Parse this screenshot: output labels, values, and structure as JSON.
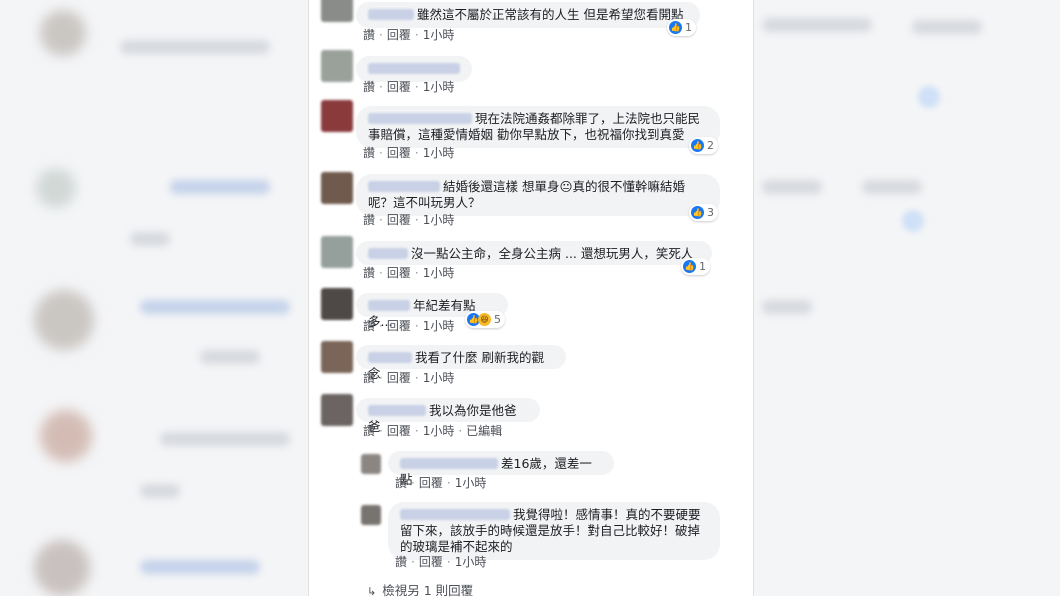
{
  "actions": {
    "like": "讚",
    "reply": "回覆",
    "edited": "已編輯"
  },
  "comments": [
    {
      "text": "雖然這不屬於正常該有的人生 但是希望您看開點",
      "time": "1小時",
      "reactions": "1"
    },
    {
      "text": "",
      "time": "1小時"
    },
    {
      "text": "現在法院通姦都除罪了，上法院也只能民事賠償，這種愛情婚姻 勸你早點放下，也祝福你找到真愛",
      "time": "1小時",
      "reactions": "2"
    },
    {
      "text": "結婚後還這樣 想單身😐真的很不懂幹嘛結婚呢？這不叫玩男人？",
      "time": "1小時",
      "reactions": "3"
    },
    {
      "text": "沒一點公主命，全身公主病 ... 還想玩男人，笑死人",
      "time": "1小時",
      "reactions": "1"
    },
    {
      "text": "年紀差有點多...",
      "time": "1小時",
      "reactions": "5"
    },
    {
      "text": "我看了什麼 刷新我的觀念",
      "time": "1小時"
    },
    {
      "text": "我以為你是他爸爸",
      "time": "1小時"
    }
  ],
  "replies": [
    {
      "text": "差16歲，還差一點",
      "time": "1小時"
    },
    {
      "text": "我覺得啦！感情事！真的不要硬要留下來，該放手的時候還是放手！對自己比較好！破掉的玻璃是補不起來的",
      "time": "1小時"
    }
  ],
  "more_replies": "檢視另 1 則回覆"
}
